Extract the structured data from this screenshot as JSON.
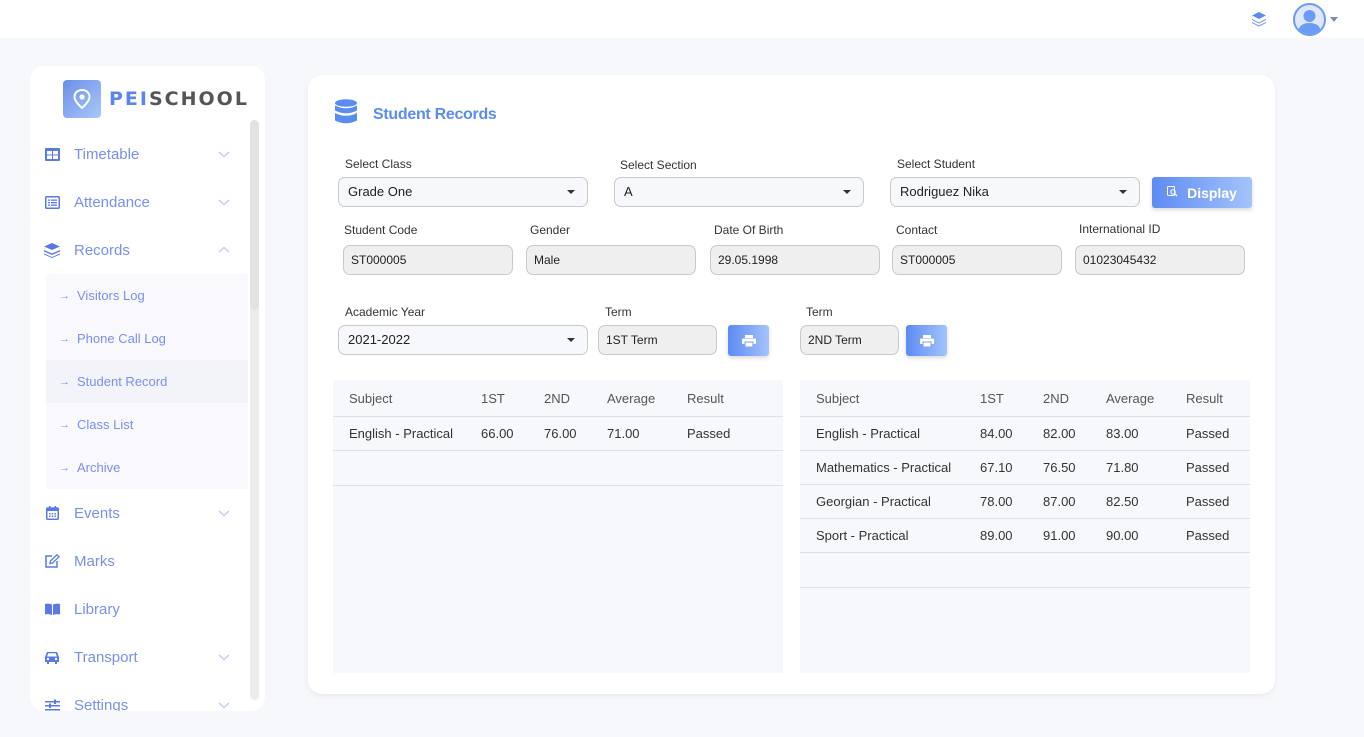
{
  "header": {
    "layers_icon": "layers-icon",
    "avatar_icon": "user-avatar-icon"
  },
  "sidebar": {
    "logo": {
      "part1": "PEI",
      "part2": "SCHOOL"
    },
    "items": [
      {
        "label": "Timetable",
        "icon": "table-grid-icon",
        "expandable": true,
        "expanded": false
      },
      {
        "label": "Attendance",
        "icon": "list-icon",
        "expandable": true,
        "expanded": false
      },
      {
        "label": "Records",
        "icon": "layers-icon",
        "expandable": true,
        "expanded": true,
        "children": [
          {
            "label": "Visitors Log",
            "active": false
          },
          {
            "label": "Phone Call Log",
            "active": false
          },
          {
            "label": "Student Record",
            "active": true
          },
          {
            "label": "Class List",
            "active": false
          },
          {
            "label": "Archive",
            "active": false
          }
        ]
      },
      {
        "label": "Events",
        "icon": "calendar-icon",
        "expandable": true,
        "expanded": false
      },
      {
        "label": "Marks",
        "icon": "edit-icon",
        "expandable": false
      },
      {
        "label": "Library",
        "icon": "book-icon",
        "expandable": false
      },
      {
        "label": "Transport",
        "icon": "car-icon",
        "expandable": true,
        "expanded": false
      },
      {
        "label": "Settings",
        "icon": "sliders-icon",
        "expandable": true,
        "expanded": false
      }
    ]
  },
  "main": {
    "title": "Student Records",
    "filters": {
      "class": {
        "label": "Select Class",
        "value": "Grade One"
      },
      "section": {
        "label": "Select Section",
        "value": "A"
      },
      "student": {
        "label": "Select Student",
        "value": "Rodriguez Nika"
      },
      "display_button": "Display"
    },
    "info": {
      "student_code": {
        "label": "Student Code",
        "value": "ST000005"
      },
      "gender": {
        "label": "Gender",
        "value": "Male"
      },
      "dob": {
        "label": "Date Of Birth",
        "value": "29.05.1998"
      },
      "contact": {
        "label": "Contact",
        "value": "ST000005"
      },
      "international_id": {
        "label": "International ID",
        "value": "01023045432"
      }
    },
    "academic_year": {
      "label": "Academic Year",
      "value": "2021-2022"
    },
    "term1": {
      "label": "Term",
      "value": "1ST Term"
    },
    "term2": {
      "label": "Term",
      "value": "2ND Term"
    },
    "columns": [
      "Subject",
      "1ST",
      "2ND",
      "Average",
      "Result"
    ],
    "table1": [
      [
        "English - Practical",
        "66.00",
        "76.00",
        "71.00",
        "Passed"
      ]
    ],
    "table2": [
      [
        "English - Practical",
        "84.00",
        "82.00",
        "83.00",
        "Passed"
      ],
      [
        "Mathematics - Practical",
        "67.10",
        "76.50",
        "71.80",
        "Passed"
      ],
      [
        "Georgian - Practical",
        "78.00",
        "87.00",
        "82.50",
        "Passed"
      ],
      [
        "Sport - Practical",
        "89.00",
        "91.00",
        "90.00",
        "Passed"
      ]
    ]
  },
  "colors": {
    "accent": "#5b8def",
    "nav_text": "#7a8ef0",
    "background": "#f7f8fc"
  }
}
